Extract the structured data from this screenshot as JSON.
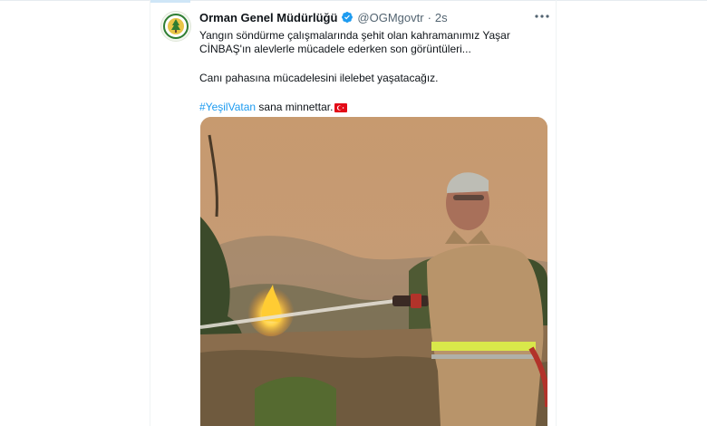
{
  "tweet": {
    "display_name": "Orman Genel Müdürlüğü",
    "handle": "@OGMgovtr",
    "separator": "·",
    "time": "2s",
    "more_icon": "more-dots-icon",
    "verified_icon": "verified-badge-icon",
    "text_line1": "Yangın söndürme çalışmalarında şehit olan kahramanımız Yaşar CİNBAŞ'ın alevlerle mücadele ederken son görüntüleri...",
    "text_line2": "Canı pahasına mücadelesini ilelebet yaşatacağız.",
    "hashtag": "#YeşilVatan",
    "text_line3_rest": " sana minnettar.",
    "flag_icon": "turkey-flag-icon"
  },
  "colors": {
    "hashtag": "#1d9bf0",
    "verified": "#1d9bf0",
    "muted_text": "#536471"
  }
}
